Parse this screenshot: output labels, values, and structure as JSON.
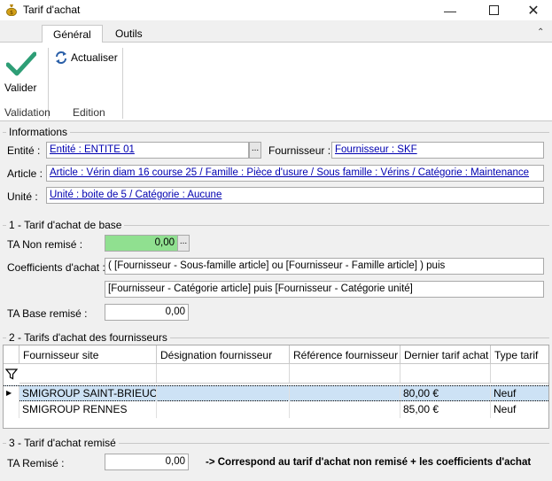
{
  "window": {
    "title": "Tarif d'achat"
  },
  "ribbon": {
    "tabs": [
      "Général",
      "Outils"
    ],
    "valider_label": "Valider",
    "actualiser_label": "Actualiser",
    "groups": [
      "Validation",
      "Edition"
    ]
  },
  "informations": {
    "title": "Informations",
    "entite_label": "Entité :",
    "entite_value": "Entité : ENTITE 01",
    "fournisseur_label": "Fournisseur :",
    "fournisseur_value": "Fournisseur : SKF",
    "article_label": "Article :",
    "article_value": "Article : Vérin diam 16 course 25 / Famille : Pièce d'usure / Sous famille : Vérins / Catégorie : Maintenance",
    "unite_label": "Unité :",
    "unite_value": "Unité : boite de 5 / Catégorie : Aucune"
  },
  "base": {
    "title": "1 - Tarif d'achat de base",
    "ta_non_remise_label": "TA Non remisé :",
    "ta_non_remise_value": "0,00",
    "coef_label": "Coefficients d'achat :",
    "coef_line1": "( [Fournisseur - Sous-famille article] ou [Fournisseur - Famille article] ) puis",
    "coef_line2": "[Fournisseur - Catégorie article] puis [Fournisseur - Catégorie unité]",
    "ta_base_label": "TA Base remisé :",
    "ta_base_value": "0,00"
  },
  "fournisseurs": {
    "title": "2 - Tarifs d'achat des fournisseurs",
    "columns": [
      "Fournisseur site",
      "Désignation fournisseur",
      "Référence fournisseur",
      "Dernier tarif achat",
      "Type tarif"
    ],
    "rows": [
      [
        "SMIGROUP SAINT-BRIEUC",
        "",
        "",
        "80,00 €",
        "Neuf"
      ],
      [
        "SMIGROUP RENNES",
        "",
        "",
        "85,00 €",
        "Neuf"
      ]
    ]
  },
  "remise": {
    "title": "3 - Tarif d'achat remisé",
    "ta_remise_label": "TA Remisé :",
    "ta_remise_value": "0,00",
    "note": "-> Correspond au tarif d'achat non remisé + les coefficients d'achat"
  },
  "colors": {
    "accent_green": "#2e9e76",
    "highlight_field": "#90e090",
    "selection": "#cde2f5"
  }
}
